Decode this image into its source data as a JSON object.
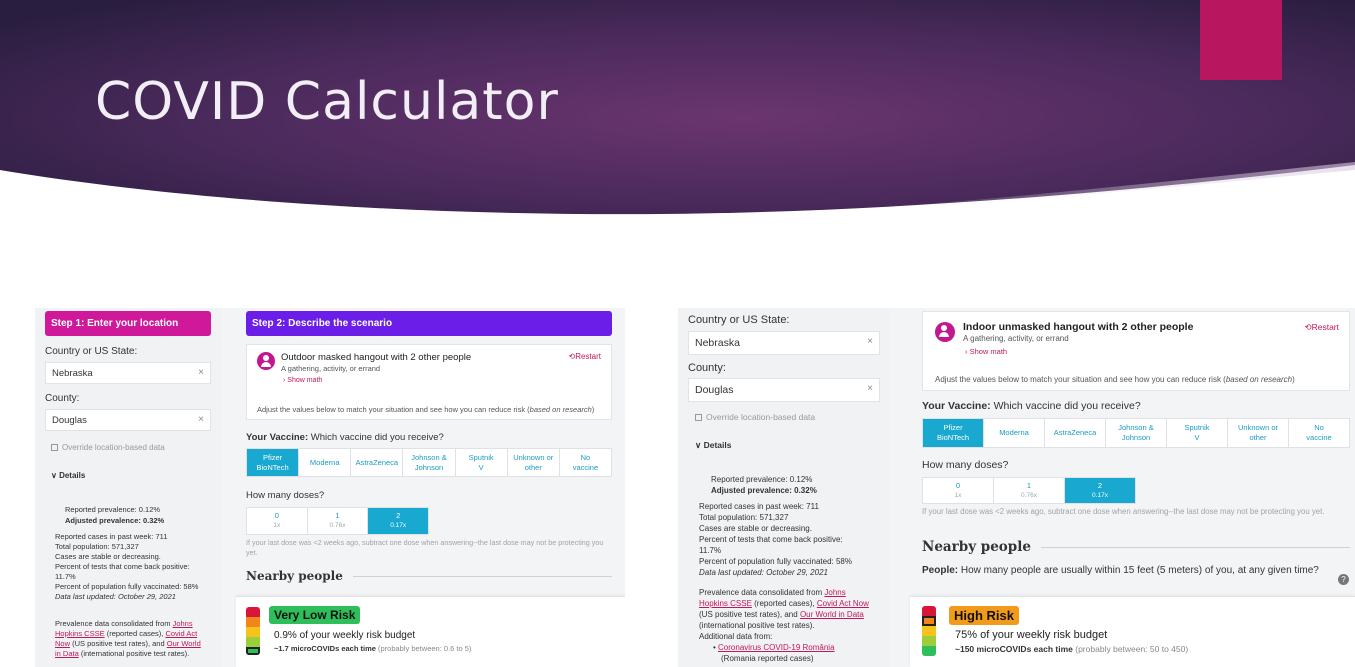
{
  "slide": {
    "title": "COVID Calculator",
    "colors": {
      "banner_dark": "#2a1f3f",
      "banner_mid": "#5c2f64",
      "accent": "#b8175f"
    }
  },
  "left": {
    "step1": "Step 1: Enter your location",
    "step2": "Step 2: Describe the scenario",
    "country_label": "Country or US State:",
    "country_value": "Nebraska",
    "county_label": "County:",
    "county_value": "Douglas",
    "clear_glyph": "×",
    "override": "Override location-based data",
    "details": "Details",
    "reported_prevalence": "Reported prevalence: 0.12%",
    "adjusted_prevalence": "Adjusted prevalence: 0.32%",
    "cases_week": "Reported cases in past week: 711",
    "population": "Total population: 571,327",
    "trend": "Cases are stable or decreasing.",
    "positive_tests": "Percent of tests that come back positive:",
    "positive_value": "11.7%",
    "vaccinated": "Percent of population fully vaccinated: 58%",
    "updated": "Data last updated: October 29, 2021",
    "source_prefix": "Prevalence data consolidated from ",
    "source_jh": "Johns Hopkins CSSE",
    "source_mid": " (reported cases), ",
    "source_covid_act": "Covid Act Now",
    "source_mid2": " (US positive test rates), and ",
    "source_owid": "Our World in Data",
    "source_end": " (international positive test rates).",
    "scenario_title": "Outdoor masked hangout with 2 other people",
    "scenario_sub": "A gathering, activity, or errand",
    "show_math": "› Show math",
    "restart": "⟲Restart",
    "adjust_text": "Adjust the values below to match your situation and see how you can reduce risk (",
    "adjust_em": "based on research",
    "adjust_end": ")",
    "vaccine_q_bold": "Your Vaccine:",
    "vaccine_q": " Which vaccine did you receive?",
    "doses_q": "How many doses?",
    "dose_hint": "If your last dose was <2 weeks ago, subtract one dose when answering--the last dose may not be protecting you yet.",
    "nearby": "Nearby people",
    "risk_label": "Very Low Risk",
    "risk_budget": "0.9% of your weekly risk budget",
    "risk_micro": "~1.7 microCOVIDs each time",
    "risk_range": " (probably between: 0.6 to 5)",
    "risk_color": "#2fbf5a"
  },
  "right": {
    "country_label": "Country or US State:",
    "country_value": "Nebraska",
    "county_label": "County:",
    "county_value": "Douglas",
    "clear_glyph": "×",
    "override": "Override location-based data",
    "details": "Details",
    "reported_prevalence": "Reported prevalence: 0.12%",
    "adjusted_prevalence": "Adjusted prevalence: 0.32%",
    "cases_week": "Reported cases in past week: 711",
    "population": "Total population: 571,327",
    "trend": "Cases are stable or decreasing.",
    "positive_tests": "Percent of tests that come back positive:",
    "positive_value": "11.7%",
    "vaccinated": "Percent of population fully vaccinated: 58%",
    "updated": "Data last updated: October 29, 2021",
    "source_prefix": "Prevalence data consolidated from ",
    "source_jh": "Johns Hopkins CSSE",
    "source_mid": " (reported cases), ",
    "source_covid_act": "Covid Act Now",
    "source_mid2": " (US positive test rates), and ",
    "source_owid": "Our World in Data",
    "source_end": " (international positive test rates).",
    "additional": "Additional data from:",
    "additional_item": "Coronavirus COVID-19 România",
    "additional_item_note": "(Romania reported cases)",
    "scenario_title": "Indoor unmasked hangout with 2 other people",
    "scenario_sub": "A gathering, activity, or errand",
    "show_math": "› Show math",
    "restart": "⟲Restart",
    "adjust_text": "Adjust the values below to match your situation and see how you can reduce risk (",
    "adjust_em": "based on research",
    "adjust_end": ")",
    "vaccine_q_bold": "Your Vaccine:",
    "vaccine_q": " Which vaccine did you receive?",
    "doses_q": "How many doses?",
    "dose_hint": "If your last dose was <2 weeks ago, subtract one dose when answering--the last dose may not be protecting you yet.",
    "nearby": "Nearby people",
    "people_q_bold": "People:",
    "people_q": " How many people are usually within 15 feet (5 meters) of you, at any given time?",
    "help_glyph": "?",
    "risk_label": "High Risk",
    "risk_budget": "75% of your weekly risk budget",
    "risk_micro": "~150 microCOVIDs each time",
    "risk_range": " (probably between: 50 to 450)",
    "risk_color": "#f29a1a"
  },
  "vaccines": [
    {
      "l1": "Pfizer",
      "l2": "BioNTech",
      "selected": true
    },
    {
      "l1": "Moderna",
      "l2": "",
      "selected": false
    },
    {
      "l1": "AstraZeneca",
      "l2": "",
      "selected": false
    },
    {
      "l1": "Johnson &",
      "l2": "Johnson",
      "selected": false
    },
    {
      "l1": "Sputnik",
      "l2": "V",
      "selected": false
    },
    {
      "l1": "Unknown or",
      "l2": "other",
      "selected": false
    },
    {
      "l1": "No",
      "l2": "vaccine",
      "selected": false
    }
  ],
  "doses": [
    {
      "n": "0",
      "m": "1x",
      "selected": false
    },
    {
      "n": "1",
      "m": "0.76x",
      "selected": false
    },
    {
      "n": "2",
      "m": "0.17x",
      "selected": true
    }
  ]
}
